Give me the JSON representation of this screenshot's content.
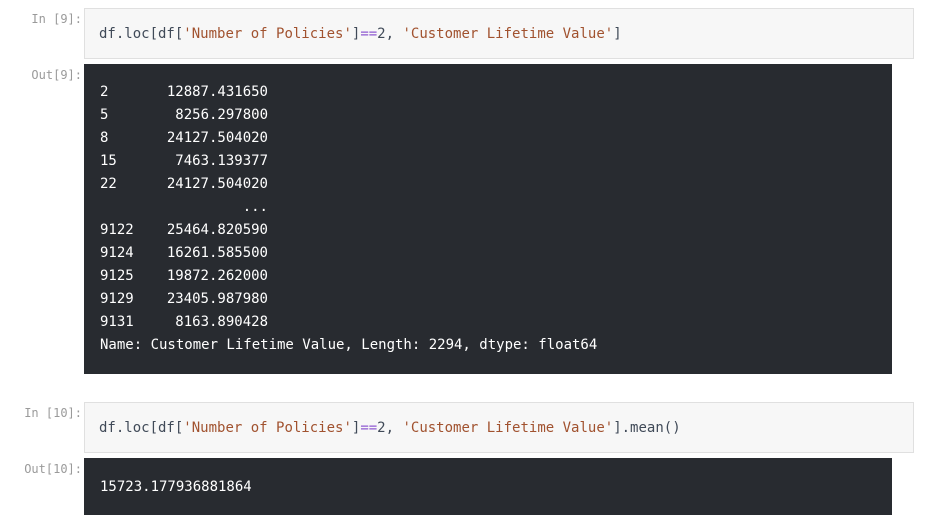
{
  "cell9": {
    "in_prompt": "In [9]:",
    "out_prompt": "Out[9]:",
    "code": {
      "t1": "df.loc[df[",
      "t2": "'Number of Policies'",
      "t3": "]",
      "t4": "==",
      "t5": "2, ",
      "t6": "'Customer Lifetime Value'",
      "t7": "]"
    },
    "rows": [
      {
        "index": "2",
        "value": "12887.431650"
      },
      {
        "index": "5",
        "value": "8256.297800"
      },
      {
        "index": "8",
        "value": "24127.504020"
      },
      {
        "index": "15",
        "value": "7463.139377"
      },
      {
        "index": "22",
        "value": "24127.504020"
      },
      {
        "index": "",
        "value": "..."
      },
      {
        "index": "9122",
        "value": "25464.820590"
      },
      {
        "index": "9124",
        "value": "16261.585500"
      },
      {
        "index": "9125",
        "value": "19872.262000"
      },
      {
        "index": "9129",
        "value": "23405.987980"
      },
      {
        "index": "9131",
        "value": "8163.890428"
      }
    ],
    "footer": "Name: Customer Lifetime Value, Length: 2294, dtype: float64"
  },
  "cell10": {
    "in_prompt": "In [10]:",
    "out_prompt": "Out[10]:",
    "code": {
      "t1": "df.loc[df[",
      "t2": "'Number of Policies'",
      "t3": "]",
      "t4": "==",
      "t5": "2, ",
      "t6": "'Customer Lifetime Value'",
      "t7": "].mean()"
    },
    "result": "15723.177936881864"
  }
}
